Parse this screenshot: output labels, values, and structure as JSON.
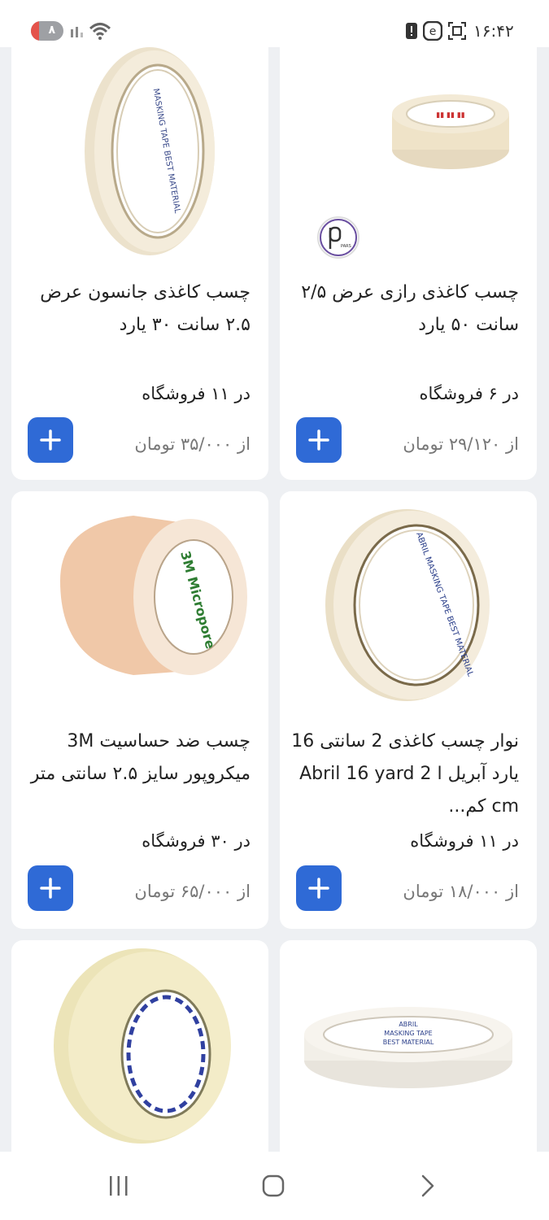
{
  "status_bar": {
    "battery_level": "۸",
    "battery_fraction": 0.08,
    "time": "۱۶:۴۲"
  },
  "colors": {
    "accent": "#2f6ad6",
    "card_bg": "#ffffff",
    "page_bg": "#eef0f3",
    "price_text": "#777777"
  },
  "products": [
    {
      "title": "چسب کاغذی رازی عرض ۲/۵ سانت ۵۰ یارد",
      "stores": "در ۶ فروشگاه",
      "price": "از ۲۹/۱۲۰ تومان",
      "add_icon": "plus-icon",
      "image": "masking-tape-roll-flat-photo",
      "brand_logo": "PARS"
    },
    {
      "title": "چسب کاغذی جانسون عرض ۲.۵ سانت ۳۰ یارد",
      "stores": "در ۱۱ فروشگاه",
      "price": "از ۳۵/۰۰۰ تومان",
      "add_icon": "plus-icon",
      "image": "masking-tape-roll-upright-photo"
    },
    {
      "title": "نوار چسب کاغذی 2 سانتی 16 یارد آبریل ا Abril 16 yard 2 cm کم...",
      "stores": "در ۱۱ فروشگاه",
      "price": "از ۱۸/۰۰۰ تومان",
      "add_icon": "plus-icon",
      "image": "abril-masking-tape-photo"
    },
    {
      "title": "چسب ضد حساسیت 3M میکروپور سایز ۲.۵ سانتی متر",
      "stores": "در ۳۰ فروشگاه",
      "price": "از ۶۵/۰۰۰ تومان",
      "add_icon": "plus-icon",
      "image": "3m-micropore-tape-photo"
    },
    {
      "image": "abril-masking-tape-flat-photo",
      "label_lines": [
        "ABRIL",
        "MASKING TAPE",
        "BEST MATERIAL"
      ]
    },
    {
      "image": "wide-masking-tape-photo"
    }
  ],
  "nav": {
    "recents_icon": "recents-icon",
    "home_icon": "home-icon",
    "back_icon": "back-icon"
  }
}
